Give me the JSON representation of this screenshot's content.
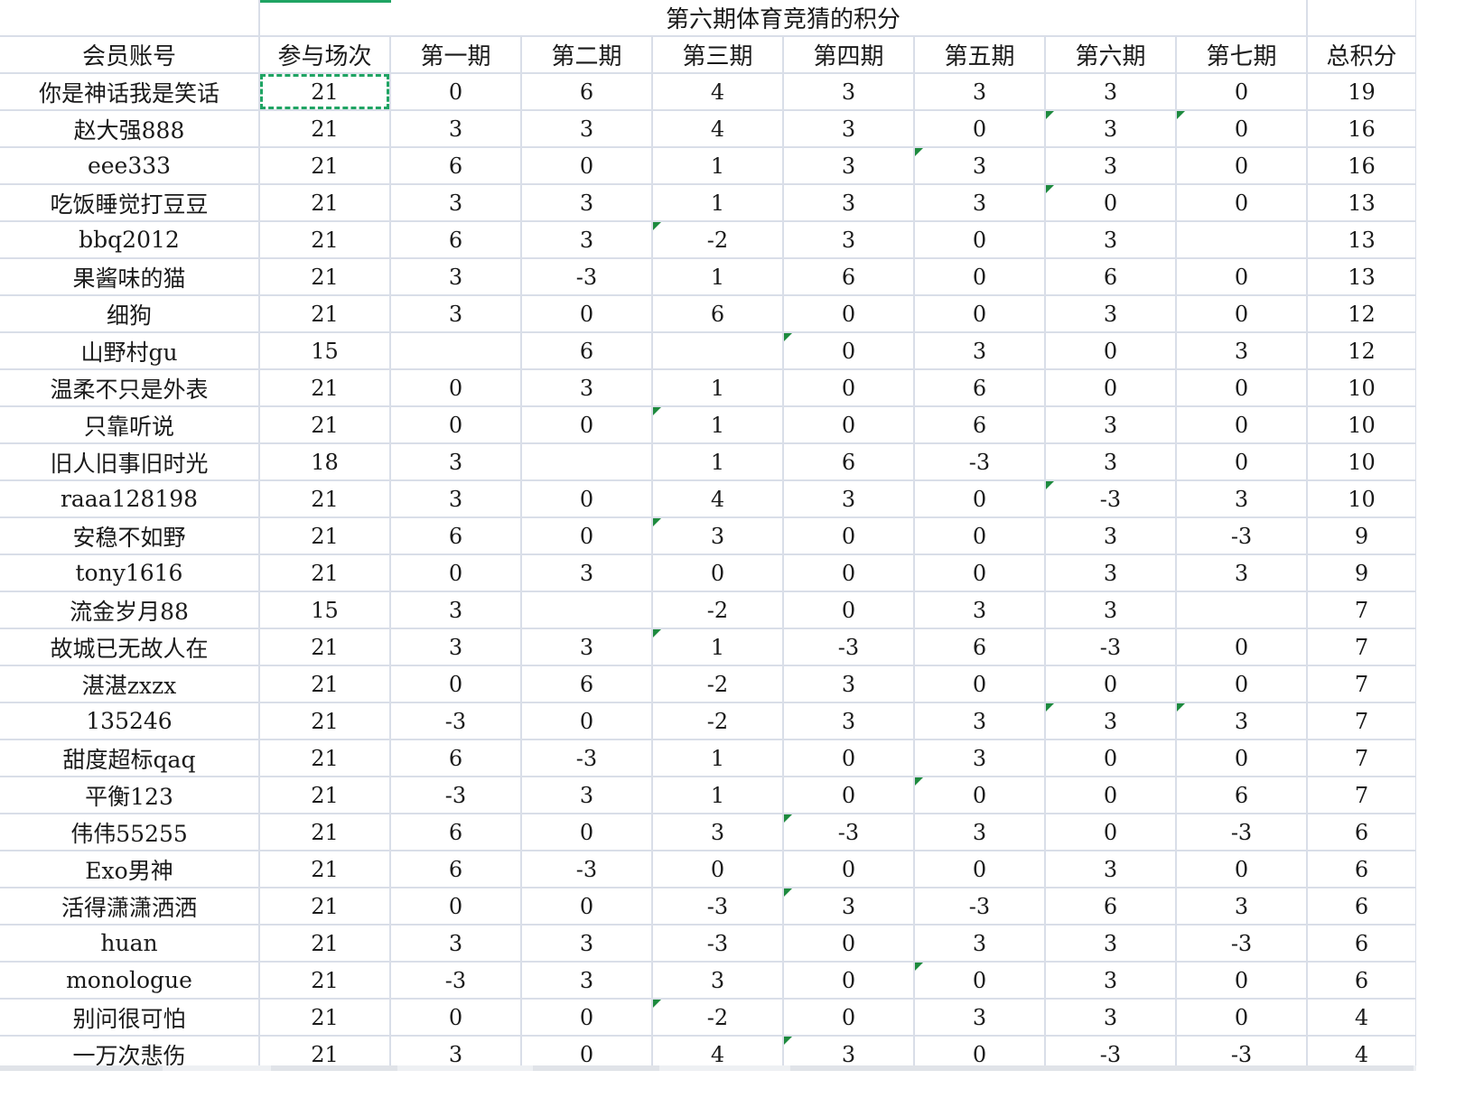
{
  "sheet_title": "第六期体育竞猜的积分",
  "headers": [
    "会员账号",
    "参与场次",
    "第一期",
    "第二期",
    "第三期",
    "第四期",
    "第五期",
    "第六期",
    "第七期",
    "总积分"
  ],
  "rows": [
    [
      "你是神话我是笑话",
      "21",
      "0",
      "6",
      "4",
      "3",
      "3",
      "3",
      "0",
      "19"
    ],
    [
      "赵大强888",
      "21",
      "3",
      "3",
      "4",
      "3",
      "0",
      "3",
      "0",
      "16"
    ],
    [
      "eee333",
      "21",
      "6",
      "0",
      "1",
      "3",
      "3",
      "3",
      "0",
      "16"
    ],
    [
      "吃饭睡觉打豆豆",
      "21",
      "3",
      "3",
      "1",
      "3",
      "3",
      "0",
      "0",
      "13"
    ],
    [
      "bbq2012",
      "21",
      "6",
      "3",
      "-2",
      "3",
      "0",
      "3",
      "",
      "13"
    ],
    [
      "果酱味的猫",
      "21",
      "3",
      "-3",
      "1",
      "6",
      "0",
      "6",
      "0",
      "13"
    ],
    [
      "细狗",
      "21",
      "3",
      "0",
      "6",
      "0",
      "0",
      "3",
      "0",
      "12"
    ],
    [
      "山野村gu",
      "15",
      "",
      "6",
      "",
      "0",
      "3",
      "0",
      "3",
      "12"
    ],
    [
      "温柔不只是外表",
      "21",
      "0",
      "3",
      "1",
      "0",
      "6",
      "0",
      "0",
      "10"
    ],
    [
      "只靠听说",
      "21",
      "0",
      "0",
      "1",
      "0",
      "6",
      "3",
      "0",
      "10"
    ],
    [
      "旧人旧事旧时光",
      "18",
      "3",
      "",
      "1",
      "6",
      "-3",
      "3",
      "0",
      "10"
    ],
    [
      "raaa128198",
      "21",
      "3",
      "0",
      "4",
      "3",
      "0",
      "-3",
      "3",
      "10"
    ],
    [
      "安稳不如野",
      "21",
      "6",
      "0",
      "3",
      "0",
      "0",
      "3",
      "-3",
      "9"
    ],
    [
      "tony1616",
      "21",
      "0",
      "3",
      "0",
      "0",
      "0",
      "3",
      "3",
      "9"
    ],
    [
      "流金岁月88",
      "15",
      "3",
      "",
      "-2",
      "0",
      "3",
      "3",
      "",
      "7"
    ],
    [
      "故城已无故人在",
      "21",
      "3",
      "3",
      "1",
      "-3",
      "6",
      "-3",
      "0",
      "7"
    ],
    [
      "湛湛zxzx",
      "21",
      "0",
      "6",
      "-2",
      "3",
      "0",
      "0",
      "0",
      "7"
    ],
    [
      "135246",
      "21",
      "-3",
      "0",
      "-2",
      "3",
      "3",
      "3",
      "3",
      "7"
    ],
    [
      "甜度超标qaq",
      "21",
      "6",
      "-3",
      "1",
      "0",
      "3",
      "0",
      "0",
      "7"
    ],
    [
      "平衡123",
      "21",
      "-3",
      "3",
      "1",
      "0",
      "0",
      "0",
      "6",
      "7"
    ],
    [
      "伟伟55255",
      "21",
      "6",
      "0",
      "3",
      "-3",
      "3",
      "0",
      "-3",
      "6"
    ],
    [
      "Exo男神",
      "21",
      "6",
      "-3",
      "0",
      "0",
      "0",
      "3",
      "0",
      "6"
    ],
    [
      "活得潇潇洒洒",
      "21",
      "0",
      "0",
      "-3",
      "3",
      "-3",
      "6",
      "3",
      "6"
    ],
    [
      "huan",
      "21",
      "3",
      "3",
      "-3",
      "0",
      "3",
      "3",
      "-3",
      "6"
    ],
    [
      "monologue",
      "21",
      "-3",
      "3",
      "3",
      "0",
      "0",
      "3",
      "0",
      "6"
    ],
    [
      "别问很可怕",
      "21",
      "0",
      "0",
      "-2",
      "0",
      "3",
      "3",
      "0",
      "4"
    ],
    [
      "一万次悲伤",
      "21",
      "3",
      "0",
      "4",
      "3",
      "0",
      "-3",
      "-3",
      "4"
    ]
  ],
  "flagged_cells": [
    [
      1,
      7
    ],
    [
      1,
      8
    ],
    [
      2,
      6
    ],
    [
      3,
      7
    ],
    [
      4,
      4
    ],
    [
      7,
      5
    ],
    [
      9,
      4
    ],
    [
      11,
      7
    ],
    [
      12,
      4
    ],
    [
      15,
      4
    ],
    [
      17,
      7
    ],
    [
      17,
      8
    ],
    [
      19,
      6
    ],
    [
      20,
      5
    ],
    [
      22,
      5
    ],
    [
      24,
      6
    ],
    [
      25,
      4
    ],
    [
      26,
      5
    ]
  ],
  "selected_cell": [
    0,
    1
  ],
  "colors": {
    "grid": "#d9dee8",
    "selection": "#1fa463",
    "flag": "#1d8a3e"
  }
}
